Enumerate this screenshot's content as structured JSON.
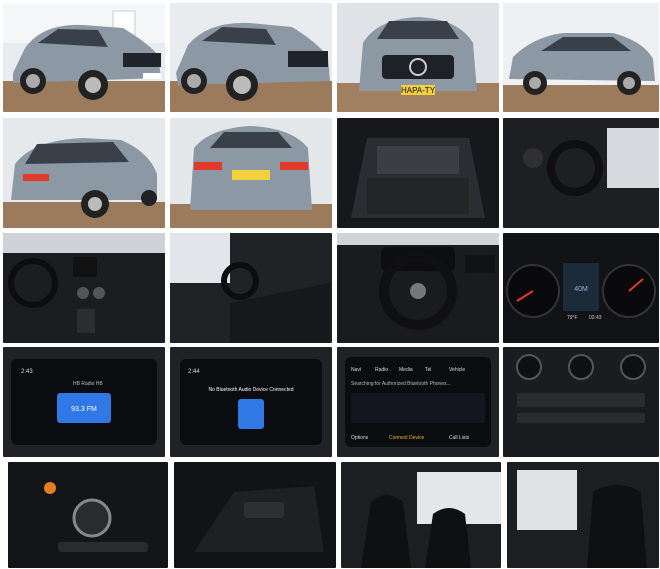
{
  "gallery": {
    "plate_text": "HAPA-TY",
    "screen_headphone": {
      "title": "HB Radio HB",
      "channel": "93.3 FM",
      "time": "2:43"
    },
    "screen_bluetooth": {
      "time": "2:44",
      "message": "No Bluetooth Audio Device Connected"
    },
    "screen_connect": {
      "menu": [
        "Navi",
        "Radio",
        "Media",
        "Tel",
        "Vehicle"
      ],
      "status": "Searching for Authorized Bluetooth Phones...",
      "options_label": "Options",
      "connect_label": "Connect Device",
      "calllists_label": "Call Lists"
    },
    "cluster": {
      "center_label": "40M",
      "temp": "79°F",
      "clock": "02:43"
    },
    "colors": {
      "car_body": "#8c99a5",
      "showroom_floor": "#9b7b5c",
      "interior_dark": "#1e1f22",
      "accent_red": "#e23a2a",
      "screen_blue": "#2f78e6"
    }
  }
}
